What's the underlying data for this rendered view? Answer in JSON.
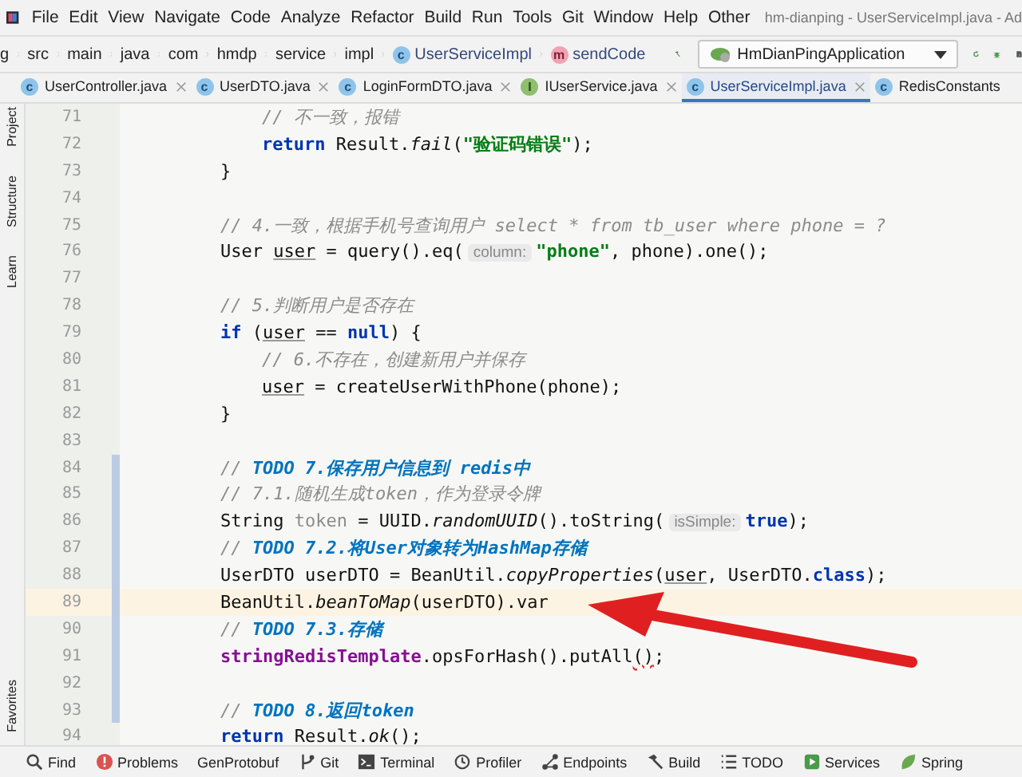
{
  "window": {
    "title": "hm-dianping - UserServiceImpl.java - Ad"
  },
  "menu": [
    "File",
    "Edit",
    "View",
    "Navigate",
    "Code",
    "Analyze",
    "Refactor",
    "Build",
    "Run",
    "Tools",
    "Git",
    "Window",
    "Help",
    "Other"
  ],
  "breadcrumb": [
    {
      "label": "g",
      "kind": "folder"
    },
    {
      "label": "src",
      "kind": "folder"
    },
    {
      "label": "main",
      "kind": "folder"
    },
    {
      "label": "java",
      "kind": "folder"
    },
    {
      "label": "com",
      "kind": "folder"
    },
    {
      "label": "hmdp",
      "kind": "folder"
    },
    {
      "label": "service",
      "kind": "folder"
    },
    {
      "label": "impl",
      "kind": "folder"
    },
    {
      "label": "UserServiceImpl",
      "kind": "class",
      "badge": "c"
    },
    {
      "label": "sendCode",
      "kind": "method",
      "badge": "m"
    }
  ],
  "run_config": "HmDianPingApplication",
  "tabs": [
    {
      "label": "UserController.java",
      "selected": false,
      "kind": "class",
      "badge": "c"
    },
    {
      "label": "UserDTO.java",
      "selected": false,
      "kind": "class",
      "badge": "c"
    },
    {
      "label": "LoginFormDTO.java",
      "selected": false,
      "kind": "class",
      "badge": "c"
    },
    {
      "label": "IUserService.java",
      "selected": false,
      "kind": "interface",
      "badge": "I"
    },
    {
      "label": "UserServiceImpl.java",
      "selected": true,
      "kind": "class",
      "badge": "c"
    },
    {
      "label": "RedisConstants",
      "selected": false,
      "kind": "class",
      "badge": "c"
    }
  ],
  "side_tools": [
    "Project",
    "Structure",
    "Learn",
    "Favorites"
  ],
  "code": [
    {
      "number": "71",
      "kind": "inner",
      "current": false,
      "changed": false,
      "tokens": [
        {
          "text": "// 不一致，报错",
          "kind": "cm"
        }
      ]
    },
    {
      "number": "72",
      "kind": "inner",
      "current": false,
      "changed": false,
      "tokens": [
        {
          "text": "return",
          "kind": "kw"
        },
        {
          "text": " Result.",
          "kind": "t"
        },
        {
          "text": "fail",
          "kind": "it"
        },
        {
          "text": "(",
          "kind": "t"
        },
        {
          "text": "\"验证码错误\"",
          "kind": "str"
        },
        {
          "text": ");",
          "kind": "t"
        }
      ]
    },
    {
      "number": "73",
      "kind": "outer",
      "current": false,
      "changed": false,
      "tokens": [
        {
          "text": "}",
          "kind": "t"
        }
      ]
    },
    {
      "number": "74",
      "current": false,
      "changed": false
    },
    {
      "number": "75",
      "kind": "outer",
      "current": false,
      "changed": false,
      "tokens": [
        {
          "text": "// 4.一致，根据手机号查询用户 select * from tb_user where phone = ?",
          "kind": "cm"
        }
      ]
    },
    {
      "number": "76",
      "kind": "outer",
      "current": false,
      "changed": false,
      "tokens": [
        {
          "text": "User ",
          "kind": "t"
        },
        {
          "text": "user",
          "kind": "u"
        },
        {
          "text": " = query().eq(",
          "kind": "t"
        },
        {
          "text": "column:",
          "kind": "hint"
        },
        {
          "text": "\"phone\"",
          "kind": "str"
        },
        {
          "text": ", phone).one();",
          "kind": "t"
        }
      ]
    },
    {
      "number": "77",
      "current": false,
      "changed": false
    },
    {
      "number": "78",
      "kind": "outer",
      "current": false,
      "changed": false,
      "tokens": [
        {
          "text": "// 5.判断用户是否存在",
          "kind": "cm"
        }
      ]
    },
    {
      "number": "79",
      "kind": "outer",
      "current": false,
      "changed": false,
      "tokens": [
        {
          "text": "if",
          "kind": "kw"
        },
        {
          "text": " (",
          "kind": "t"
        },
        {
          "text": "user",
          "kind": "u"
        },
        {
          "text": " == ",
          "kind": "t"
        },
        {
          "text": "null",
          "kind": "kw"
        },
        {
          "text": ") {",
          "kind": "t"
        }
      ]
    },
    {
      "number": "80",
      "kind": "inner",
      "current": false,
      "changed": false,
      "tokens": [
        {
          "text": "// 6.不存在，创建新用户并保存",
          "kind": "cm"
        }
      ]
    },
    {
      "number": "81",
      "kind": "inner",
      "current": false,
      "changed": false,
      "tokens": [
        {
          "text": "user",
          "kind": "u"
        },
        {
          "text": " = createUserWithPhone(phone);",
          "kind": "t"
        }
      ]
    },
    {
      "number": "82",
      "kind": "outer",
      "current": false,
      "changed": false,
      "tokens": [
        {
          "text": "}",
          "kind": "t"
        }
      ]
    },
    {
      "number": "83",
      "current": false,
      "changed": false
    },
    {
      "number": "84",
      "kind": "outer",
      "current": false,
      "changed": true,
      "tokens": [
        {
          "text": "// ",
          "kind": "cm"
        },
        {
          "text": "TODO 7.保存用户信息到 redis中",
          "kind": "todo"
        }
      ]
    },
    {
      "number": "85",
      "kind": "outer",
      "current": false,
      "changed": true,
      "tokens": [
        {
          "text": "// 7.1.随机生成token，作为登录令牌",
          "kind": "cm"
        }
      ]
    },
    {
      "number": "86",
      "kind": "outer",
      "current": false,
      "changed": true,
      "tokens": [
        {
          "text": "String ",
          "kind": "t"
        },
        {
          "text": "token",
          "kind": "unused"
        },
        {
          "text": " = UUID.",
          "kind": "t"
        },
        {
          "text": "randomUUID",
          "kind": "it"
        },
        {
          "text": "().toString(",
          "kind": "t"
        },
        {
          "text": "isSimple:",
          "kind": "hint"
        },
        {
          "text": "true",
          "kind": "kw"
        },
        {
          "text": ");",
          "kind": "t"
        }
      ]
    },
    {
      "number": "87",
      "kind": "outer",
      "current": false,
      "changed": true,
      "tokens": [
        {
          "text": "// ",
          "kind": "cm"
        },
        {
          "text": "TODO 7.2.将User对象转为HashMap存储",
          "kind": "todo"
        }
      ]
    },
    {
      "number": "88",
      "kind": "outer",
      "current": false,
      "changed": true,
      "tokens": [
        {
          "text": "UserDTO userDTO = BeanUtil.",
          "kind": "t"
        },
        {
          "text": "copyProperties",
          "kind": "it"
        },
        {
          "text": "(",
          "kind": "t"
        },
        {
          "text": "user",
          "kind": "u"
        },
        {
          "text": ", UserDTO.",
          "kind": "t"
        },
        {
          "text": "class",
          "kind": "kw"
        },
        {
          "text": ");",
          "kind": "t"
        }
      ]
    },
    {
      "number": "89",
      "kind": "outer",
      "current": true,
      "changed": true,
      "tokens": [
        {
          "text": "BeanUtil.",
          "kind": "t"
        },
        {
          "text": "beanToMap",
          "kind": "it"
        },
        {
          "text": "(userDTO).var",
          "kind": "t"
        }
      ]
    },
    {
      "number": "90",
      "kind": "outer",
      "current": false,
      "changed": true,
      "tokens": [
        {
          "text": "// ",
          "kind": "cm"
        },
        {
          "text": "TODO 7.3.存储",
          "kind": "todo"
        }
      ]
    },
    {
      "number": "91",
      "kind": "outer",
      "current": false,
      "changed": true,
      "tokens": [
        {
          "text": "stringRedisTemplate",
          "kind": "fld"
        },
        {
          "text": ".opsForHash().putAll",
          "kind": "t"
        },
        {
          "text": "()",
          "kind": "err"
        },
        {
          "text": ";",
          "kind": "t"
        }
      ]
    },
    {
      "number": "92",
      "current": false,
      "changed": true
    },
    {
      "number": "93",
      "kind": "outer",
      "current": false,
      "changed": true,
      "tokens": [
        {
          "text": "// ",
          "kind": "cm"
        },
        {
          "text": "TODO 8.返回token",
          "kind": "todo"
        }
      ]
    },
    {
      "number": "94",
      "kind": "outer",
      "current": false,
      "changed": false,
      "tokens": [
        {
          "text": "return",
          "kind": "kw"
        },
        {
          "text": " Result.",
          "kind": "t"
        },
        {
          "text": "ok",
          "kind": "it"
        },
        {
          "text": "();",
          "kind": "t"
        }
      ]
    }
  ],
  "tool_windows": [
    {
      "label": "Find",
      "kind": "search"
    },
    {
      "label": "Problems",
      "kind": "problems"
    },
    {
      "label": "GenProtobuf",
      "kind": "none"
    },
    {
      "label": "Git",
      "kind": "git"
    },
    {
      "label": "Terminal",
      "kind": "terminal"
    },
    {
      "label": "Profiler",
      "kind": "profiler"
    },
    {
      "label": "Endpoints",
      "kind": "endpoints"
    },
    {
      "label": "Build",
      "kind": "build"
    },
    {
      "label": "TODO",
      "kind": "todo"
    },
    {
      "label": "Services",
      "kind": "services"
    },
    {
      "label": "Spring",
      "kind": "spring"
    }
  ]
}
